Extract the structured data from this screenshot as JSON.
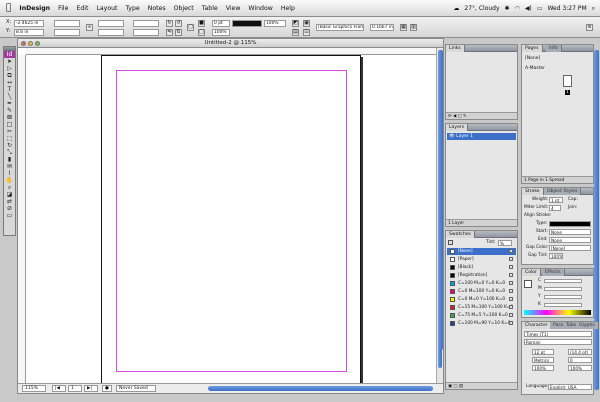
{
  "menubar": {
    "apple": "",
    "items": [
      "InDesign",
      "File",
      "Edit",
      "Layout",
      "Type",
      "Notes",
      "Object",
      "Table",
      "View",
      "Window",
      "Help"
    ],
    "weather": "27°, Cloudy",
    "clock": "Wed 3:27 PM"
  },
  "control": {
    "x_label": "X:",
    "x_value": "-2.4625 in",
    "y_label": "Y:",
    "y_value": "8.6 in",
    "stroke_weight": "0 pt",
    "zoom_pct": "100%",
    "opacity_pct": "100%",
    "frame_style": "[Basic Graphics Frame]",
    "offset": "0.1667 in"
  },
  "document": {
    "title": "Untitled-2 @ 115%",
    "zoom": "115%",
    "page_num": "1",
    "status": "Never Saved"
  },
  "panels": {
    "links": {
      "tab": "Links"
    },
    "pages": {
      "tabs": [
        "Pages",
        "Info"
      ],
      "none_label": "[None]",
      "master_label": "A-Master",
      "page_badge": "1",
      "footer": "1 Page in 1 Spread"
    },
    "layers": {
      "tab": "Layers",
      "layer_name": "Layer 1",
      "footer": "1 Layer"
    },
    "swatches": {
      "tab": "Swatches",
      "tint_label": "Tint:",
      "tint_value": "%",
      "items": [
        {
          "name": "[None]",
          "color": "#ffffff",
          "selected": true
        },
        {
          "name": "[Paper]",
          "color": "#ffffff",
          "selected": false
        },
        {
          "name": "[Black]",
          "color": "#000000",
          "selected": false
        },
        {
          "name": "[Registration]",
          "color": "#000000",
          "selected": false
        },
        {
          "name": "C=100 M=0 Y=0 K=0",
          "color": "#00a0e6",
          "selected": false
        },
        {
          "name": "C=0 M=100 Y=0 K=0",
          "color": "#e3007f",
          "selected": false
        },
        {
          "name": "C=0 M=0 Y=100 K=0",
          "color": "#fff200",
          "selected": false
        },
        {
          "name": "C=15 M=100 Y=100 K=0",
          "color": "#cf1f2e",
          "selected": false
        },
        {
          "name": "C=75 M=5 Y=100 K=0",
          "color": "#3aa845",
          "selected": false
        },
        {
          "name": "C=100 M=90 Y=10 K=0",
          "color": "#223f93",
          "selected": false
        }
      ]
    },
    "stroke": {
      "tabs": [
        "Stroke",
        "Object Styles"
      ],
      "weight_label": "Weight:",
      "weight_value": "1 pt",
      "cap_label": "Cap:",
      "miter_label": "Miter Limit:",
      "miter_value": "4",
      "join_label": "Join:",
      "align_label": "Align Stroke:",
      "type_label": "Type:",
      "start_label": "Start:",
      "start_value": "None",
      "end_label": "End:",
      "end_value": "None",
      "gap_color_label": "Gap Color:",
      "gap_color_value": "[None]",
      "gap_tint_label": "Gap Tint:",
      "gap_tint_value": "100%"
    },
    "color": {
      "tabs": [
        "Color",
        "Effects"
      ],
      "channels": [
        "C",
        "M",
        "Y",
        "K"
      ]
    },
    "character": {
      "tabs": [
        "Character",
        "Para",
        "Tabs",
        "Glyphs"
      ],
      "font": "Times (T1)",
      "style": "Roman",
      "size": "12 pt",
      "leading": "(14.4 pt)",
      "kerning": "Metrics",
      "tracking": "0",
      "vscale": "100%",
      "hscale": "100%",
      "language_label": "Language:",
      "language_value": "English: USA"
    }
  }
}
